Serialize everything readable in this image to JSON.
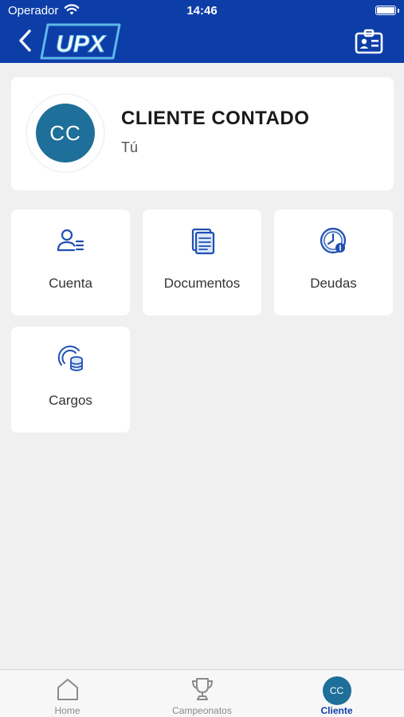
{
  "status_bar": {
    "carrier": "Operador",
    "time": "14:46"
  },
  "header": {
    "logo_text": "UPX"
  },
  "profile": {
    "initials": "CC",
    "name": "CLIENTE CONTADO",
    "subtitle": "Tú"
  },
  "tiles": [
    {
      "label": "Cuenta",
      "icon": "account-icon"
    },
    {
      "label": "Documentos",
      "icon": "documents-icon"
    },
    {
      "label": "Deudas",
      "icon": "debts-clock-icon"
    },
    {
      "label": "Cargos",
      "icon": "charges-coins-icon"
    }
  ],
  "tabbar": {
    "home": "Home",
    "campeonatos": "Campeonatos",
    "cliente": "Cliente",
    "cliente_initials": "CC",
    "active": "Cliente"
  },
  "colors": {
    "header_bg": "#0d3ea8",
    "avatar_bg": "#1e6f99",
    "icon_blue": "#1f4fb0",
    "active_tab": "#0d3ea8"
  }
}
